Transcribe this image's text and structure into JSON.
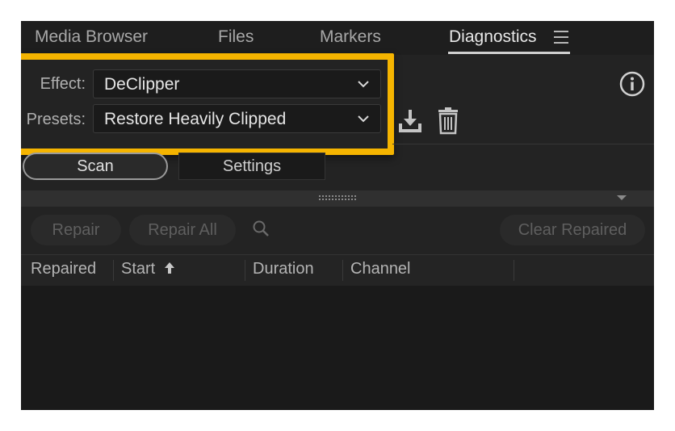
{
  "tabs": [
    {
      "label": "Media Browser",
      "active": false
    },
    {
      "label": "Files",
      "active": false
    },
    {
      "label": "Markers",
      "active": false
    },
    {
      "label": "Diagnostics",
      "active": true
    }
  ],
  "effect": {
    "label": "Effect:",
    "value": "DeClipper"
  },
  "presets": {
    "label": "Presets:",
    "value": "Restore Heavily Clipped"
  },
  "buttons": {
    "scan": "Scan",
    "settings": "Settings"
  },
  "toolbar": {
    "repair": "Repair",
    "repair_all": "Repair All",
    "clear_repaired": "Clear Repaired"
  },
  "table": {
    "columns": [
      "Repaired",
      "Start",
      "Duration",
      "Channel"
    ],
    "sort_column": "Start",
    "sort_direction": "ascending",
    "rows": []
  },
  "icons": [
    "panel-menu-icon",
    "info-icon",
    "download-preset-icon",
    "trash-icon",
    "search-icon",
    "sort-ascending-icon",
    "chevron-down-icon"
  ],
  "colors": {
    "highlight": "#f5b400",
    "panel_bg": "#232323"
  }
}
